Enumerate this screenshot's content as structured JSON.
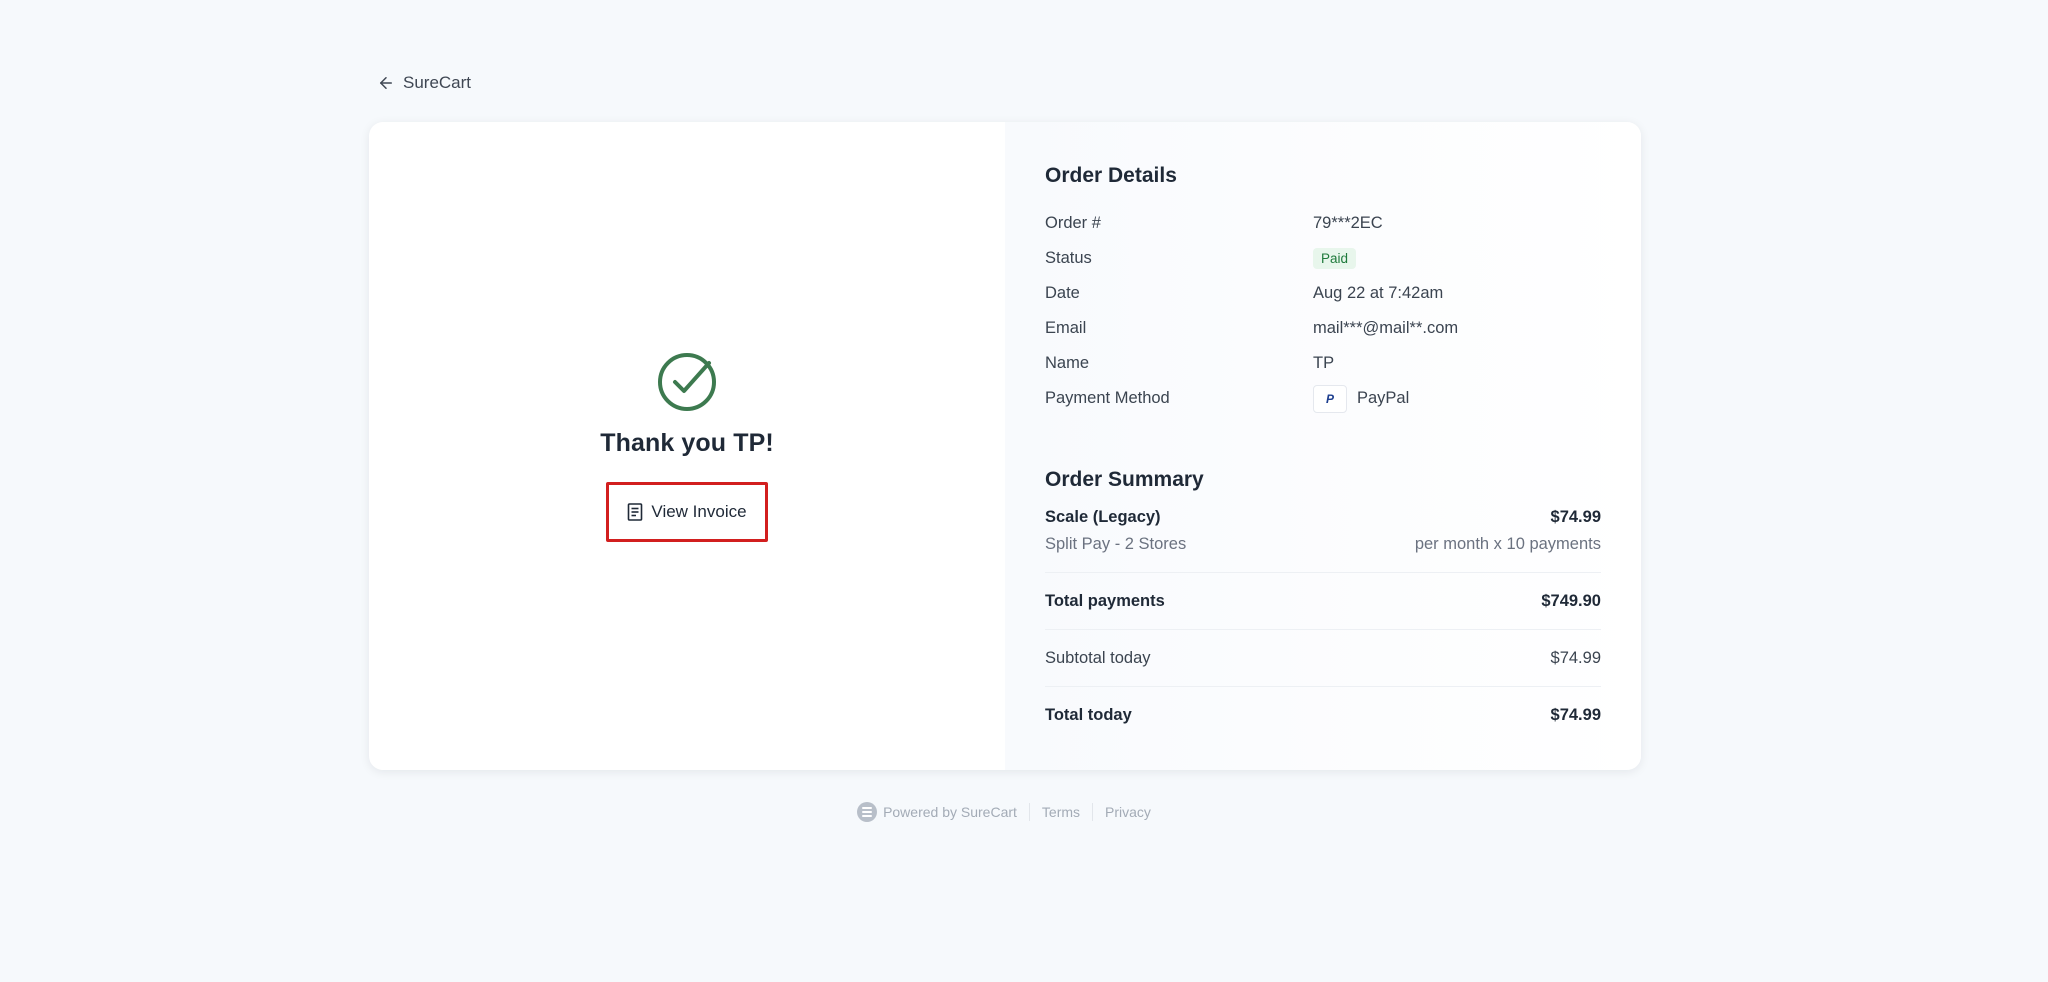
{
  "nav": {
    "back_label": "SureCart"
  },
  "confirmation": {
    "thanks_text": "Thank you TP!",
    "view_invoice_label": "View Invoice"
  },
  "order_details": {
    "title": "Order Details",
    "rows": [
      {
        "label": "Order #",
        "value": "79***2EC"
      },
      {
        "label": "Status",
        "value": "Paid"
      },
      {
        "label": "Date",
        "value": "Aug 22 at 7:42am"
      },
      {
        "label": "Email",
        "value": "mail***@mail**.com"
      },
      {
        "label": "Name",
        "value": "TP"
      },
      {
        "label": "Payment Method",
        "value": "PayPal"
      }
    ]
  },
  "order_summary": {
    "title": "Order Summary",
    "item": {
      "name": "Scale (Legacy)",
      "price": "$74.99",
      "variant": "Split Pay - 2 Stores",
      "billing": "per month x 10 payments"
    },
    "total_payments_label": "Total payments",
    "total_payments_value": "$749.90",
    "subtotal_label": "Subtotal today",
    "subtotal_value": "$74.99",
    "total_label": "Total today",
    "total_value": "$74.99"
  },
  "footer": {
    "powered_by": "Powered by SureCart",
    "terms": "Terms",
    "privacy": "Privacy"
  },
  "colors": {
    "success": "#3d7a4f",
    "highlight": "#d21f1f",
    "paid_badge_bg": "#e8f6ec"
  }
}
